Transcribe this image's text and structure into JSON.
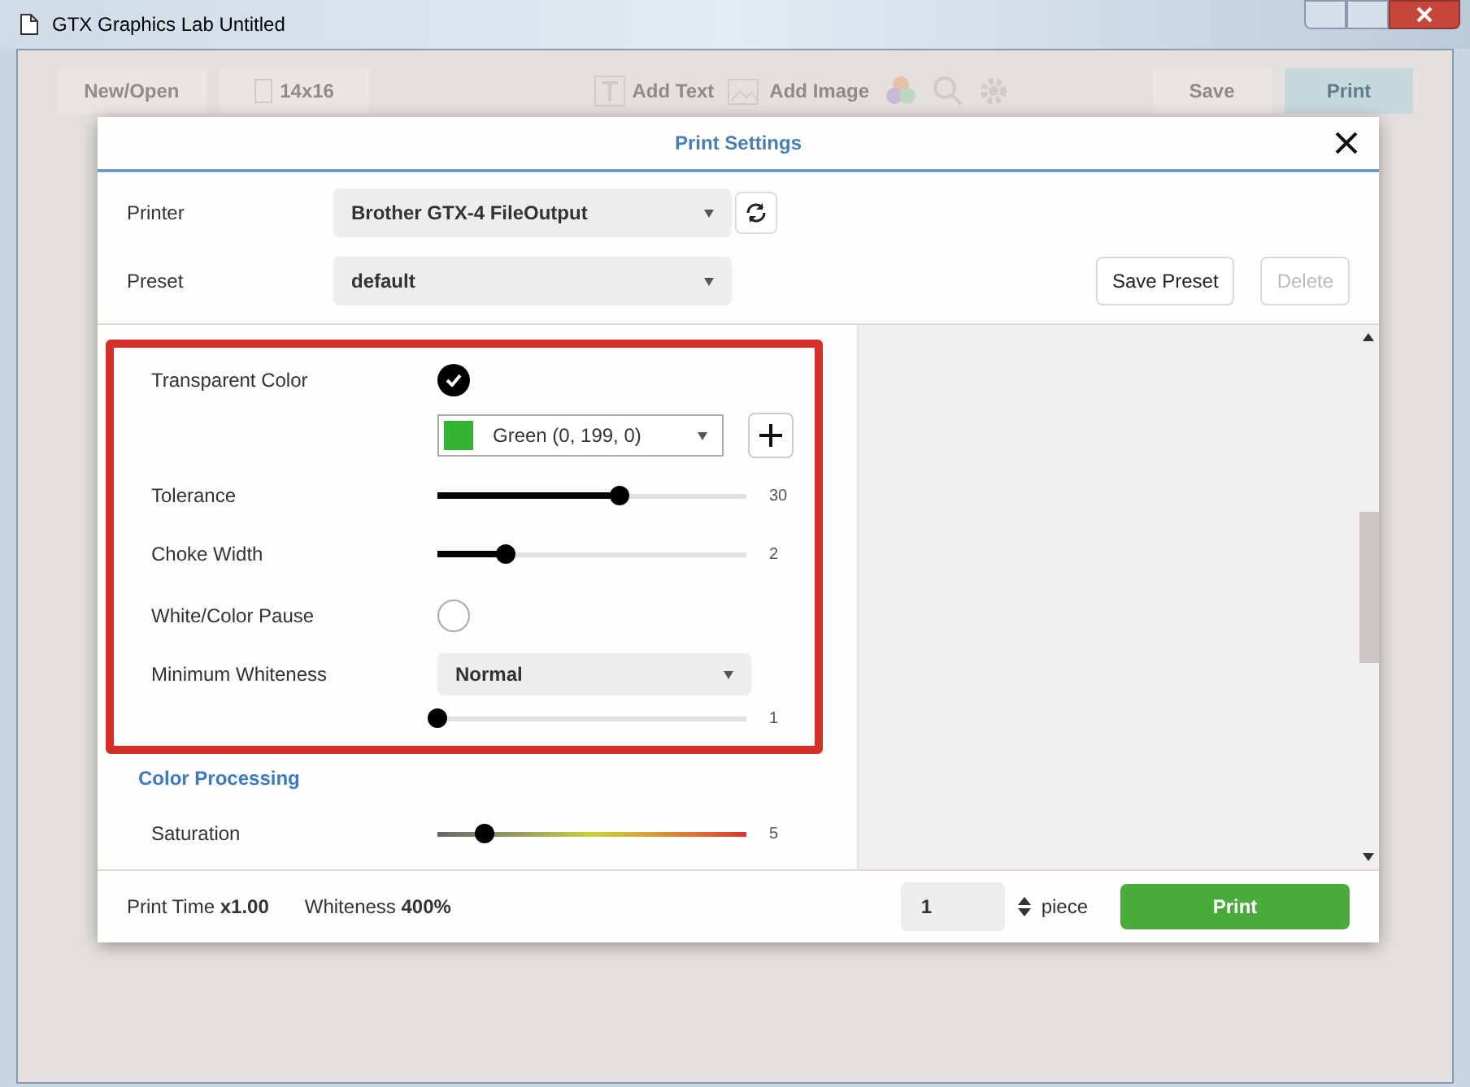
{
  "window": {
    "title": "GTX Graphics Lab Untitled"
  },
  "toolbar": [
    {
      "kind": "button",
      "label": "New/Open"
    },
    {
      "kind": "size",
      "label": "14x16"
    },
    {
      "kind": "add-text",
      "label": "Add Text"
    },
    {
      "kind": "add-image",
      "label": "Add Image"
    },
    {
      "kind": "colors"
    },
    {
      "kind": "search"
    },
    {
      "kind": "settings"
    },
    {
      "kind": "save",
      "label": "Save"
    },
    {
      "kind": "print",
      "label": "Print"
    }
  ],
  "dialog": {
    "title": "Print Settings",
    "printer": {
      "label": "Printer",
      "value": "Brother GTX-4 FileOutput"
    },
    "preset": {
      "label": "Preset",
      "value": "default"
    },
    "buttons": [
      {
        "label": "Save Preset",
        "disabled": false
      },
      {
        "label": "Delete",
        "disabled": true
      }
    ],
    "settings": [
      {
        "kind": "checkbox",
        "label": "Transparent Color",
        "checked": true
      },
      {
        "kind": "color-select",
        "value": "Green (0, 199, 0)",
        "color": "#33b233"
      },
      {
        "kind": "slider",
        "label": "Tolerance",
        "level": 0.59,
        "reading": "30"
      },
      {
        "kind": "slider",
        "label": "Choke Width",
        "level": 0.22,
        "reading": "2"
      },
      {
        "kind": "checkbox",
        "label": "White/Color Pause",
        "checked": false
      },
      {
        "kind": "select",
        "label": "Minimum Whiteness",
        "value": "Normal"
      },
      {
        "kind": "slider",
        "level": 0,
        "reading": "1"
      }
    ],
    "section_title": "Color Processing",
    "color_settings": [
      {
        "kind": "gradient-slider",
        "label": "Saturation",
        "level": 0.15,
        "reading": "5"
      }
    ],
    "footer": {
      "print_time": "Print Time **x1.00**",
      "whiteness": "Whiteness **400%**",
      "quantity": "1",
      "unit": "piece",
      "print": "Print"
    }
  }
}
